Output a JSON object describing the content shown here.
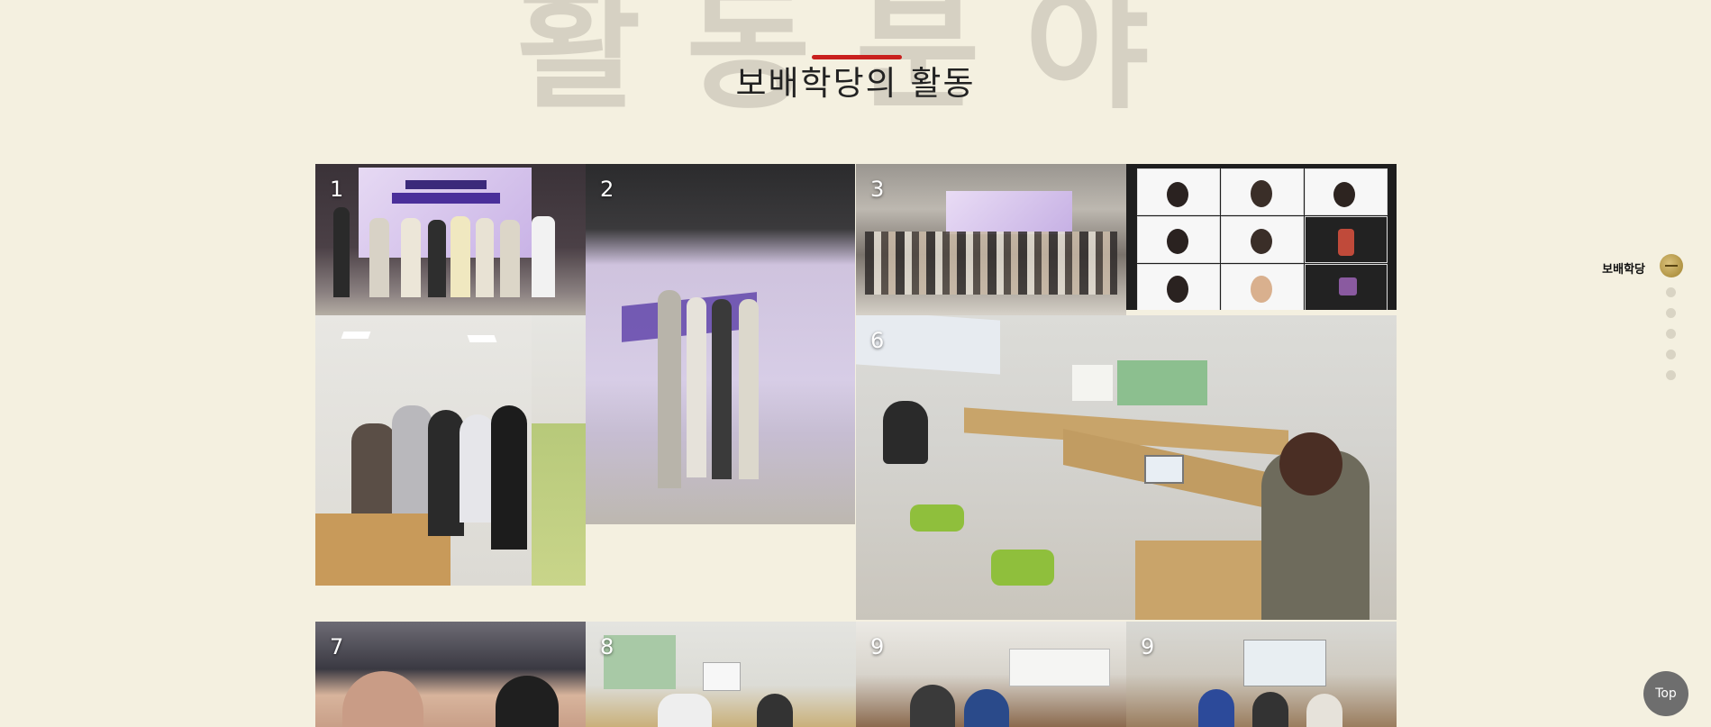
{
  "header": {
    "background_title": "활동분야",
    "section_title": "보배학당의 활동",
    "accent_color": "#c9201e"
  },
  "gallery": {
    "tiles": [
      {
        "label": "1"
      },
      {
        "label": "2"
      },
      {
        "label": "3"
      },
      {
        "label": ""
      },
      {
        "label": ""
      },
      {
        "label": "6"
      },
      {
        "label": "7"
      },
      {
        "label": "8"
      },
      {
        "label": "9"
      },
      {
        "label": "9"
      }
    ]
  },
  "side_nav": {
    "active_label": "보배학당",
    "dot_count": 5
  },
  "top_button": {
    "label": "Top"
  }
}
